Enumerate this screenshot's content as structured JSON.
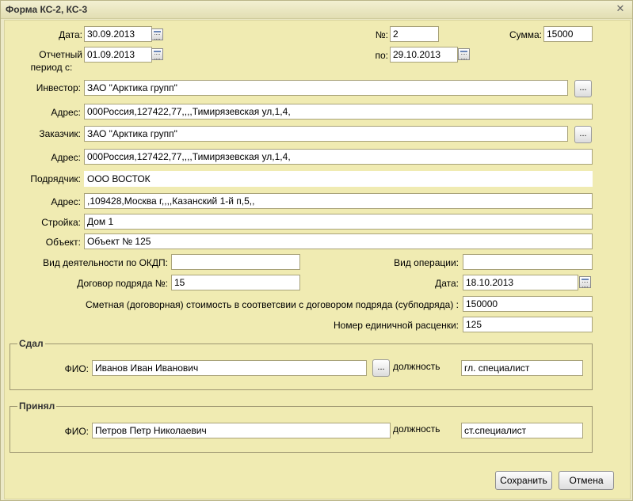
{
  "window": {
    "title": "Форма КС-2, КС-3"
  },
  "icons": {
    "close": "close-icon",
    "calendar": "calendar-icon"
  },
  "form": {
    "date_label": "Дата:",
    "date_value": "30.09.2013",
    "number_label": "№:",
    "number_value": "2",
    "sum_label": "Сумма:",
    "sum_value": "15000",
    "period_label_1": "Отчетный",
    "period_label_2": "период с:",
    "period_from": "01.09.2013",
    "period_to_label": "по:",
    "period_to": "29.10.2013",
    "investor_label": "Инвестор:",
    "investor_value": "ЗАО \"Арктика групп\"",
    "address_label": "Адрес:",
    "investor_address": "000Россия,127422,77,,,,Тимирязевская ул,1,4,",
    "customer_label": "Заказчик:",
    "customer_value": "ЗАО \"Арктика групп\"",
    "customer_address": "000Россия,127422,77,,,,Тимирязевская ул,1,4,",
    "contractor_label": "Подрядчик:",
    "contractor_value": "ООО ВОСТОК",
    "contractor_address": ",109428,Москва г,,,,Казанский 1-й п,5,,",
    "construction_label": "Стройка:",
    "construction_value": "Дом 1",
    "object_label": "Объект:",
    "object_value": "Объект № 125",
    "okdp_label": "Вид деятельности по ОКДП:",
    "okdp_value": "",
    "operation_label": "Вид операции:",
    "operation_value": "",
    "contract_label": "Договор подряда №:",
    "contract_value": "15",
    "contract_date_label": "Дата:",
    "contract_date_value": "18.10.2013",
    "estimate_label": "Сметная (договорная) стоимость в соответсвии с договором подряда (субподряда) :",
    "estimate_value": "150000",
    "rate_label": "Номер единичной расценки:",
    "rate_value": "125",
    "browse_label": "..."
  },
  "handed": {
    "legend": "Сдал",
    "fio_label": "ФИО:",
    "fio_value": "Иванов Иван Иванович",
    "position_label": "должность",
    "position_value": "гл. специалист"
  },
  "accepted": {
    "legend": "Принял",
    "fio_label": "ФИО:",
    "fio_value": "Петров Петр Николаевич",
    "position_label": "должность",
    "position_value": "ст.специалист"
  },
  "buttons": {
    "save": "Сохранить",
    "cancel": "Отмена"
  }
}
